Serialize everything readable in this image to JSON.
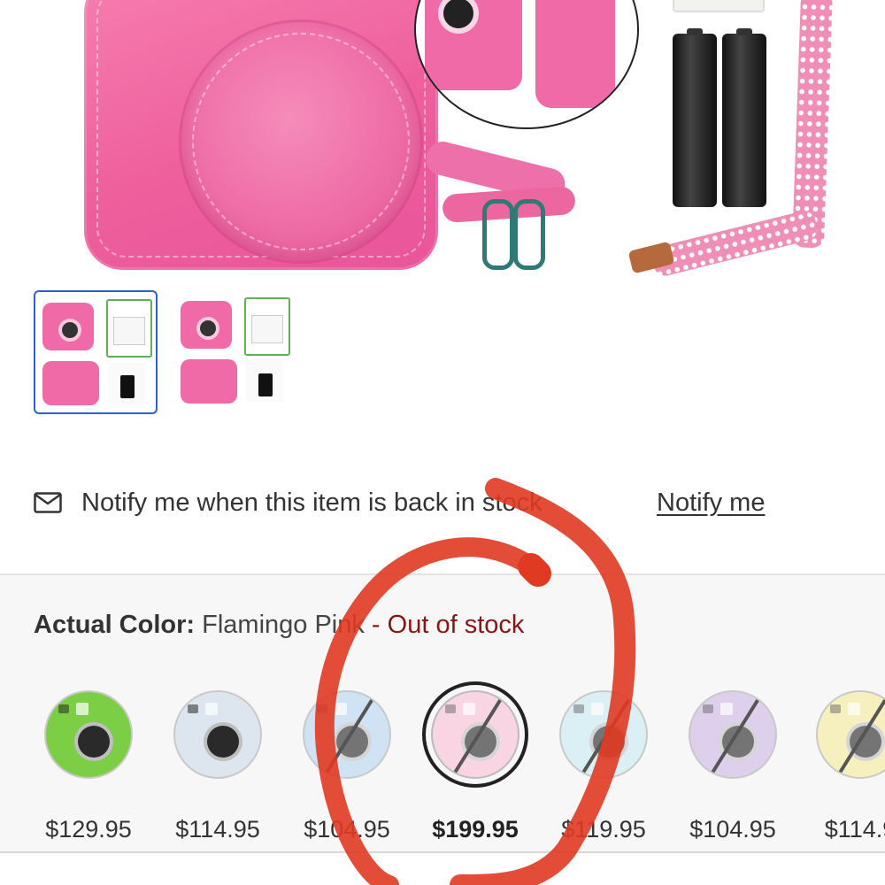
{
  "notify": {
    "text": "Notify me when this item is back in stock",
    "link": "Notify me",
    "icon": "mail-icon"
  },
  "variant": {
    "label": "Actual Color:",
    "value": "Flamingo Pink",
    "separator": " - ",
    "status": "Out of stock",
    "status_color": "#8b1414"
  },
  "swatches": [
    {
      "price": "$129.95",
      "color": "#7ccf45",
      "available": true
    },
    {
      "price": "$114.95",
      "color": "#dde6ee",
      "available": true
    },
    {
      "price": "$104.95",
      "color": "#b7d4ef",
      "available": false
    },
    {
      "price": "$199.95",
      "color": "#f6bdd3",
      "available": false,
      "selected": true
    },
    {
      "price": "$119.95",
      "color": "#c8e8ee",
      "available": false
    },
    {
      "price": "$104.95",
      "color": "#cdb6e4",
      "available": false
    },
    {
      "price": "$114.9",
      "color": "#f1e89c",
      "available": false
    }
  ],
  "colors": {
    "accent_border": "#2d62c8",
    "annotation": "#e03a22"
  }
}
